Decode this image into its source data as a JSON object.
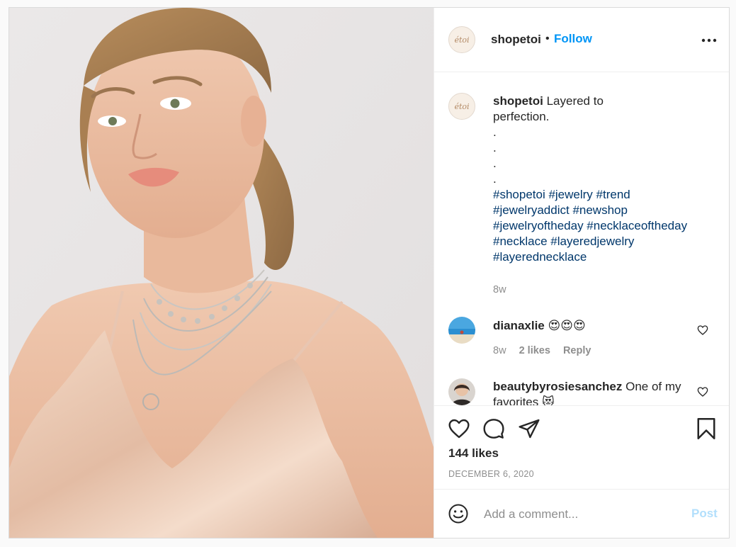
{
  "account": {
    "username": "shopetoi",
    "logo_text": "étoi",
    "follow_label": "Follow",
    "dot": "•"
  },
  "caption": {
    "username": "shopetoi",
    "text_line1": "Layered to",
    "text_line2": "perfection.",
    "dots": [
      ".",
      ".",
      ".",
      "."
    ],
    "hashtags": [
      "#shopetoi #jewelry #trend",
      "#jewelryaddict #newshop",
      "#jewelryoftheday #necklaceoftheday",
      "#necklace #layeredjewelry",
      "#layerednecklace"
    ],
    "time": "8w"
  },
  "comments": [
    {
      "username": "dianaxlie",
      "text": "😍😍😍",
      "time": "8w",
      "likes": "2 likes",
      "reply_label": "Reply"
    },
    {
      "username": "beautybyrosiesanchez",
      "text_line1": "One of my",
      "text_line2": "favorites 😻"
    }
  ],
  "actions": {
    "likes": "144 likes",
    "date": "DECEMBER 6, 2020"
  },
  "add_comment": {
    "placeholder": "Add a comment...",
    "post_label": "Post"
  },
  "icons": {
    "more": "more-horizontal-icon",
    "like": "heart-icon",
    "comment": "comment-bubble-icon",
    "share": "paper-plane-icon",
    "save": "bookmark-icon",
    "emoji": "smiley-icon"
  },
  "colors": {
    "link_blue": "#0095f6",
    "hashtag_blue": "#00376b",
    "muted_gray": "#8e8e8e",
    "post_disabled": "#b2dffc"
  }
}
